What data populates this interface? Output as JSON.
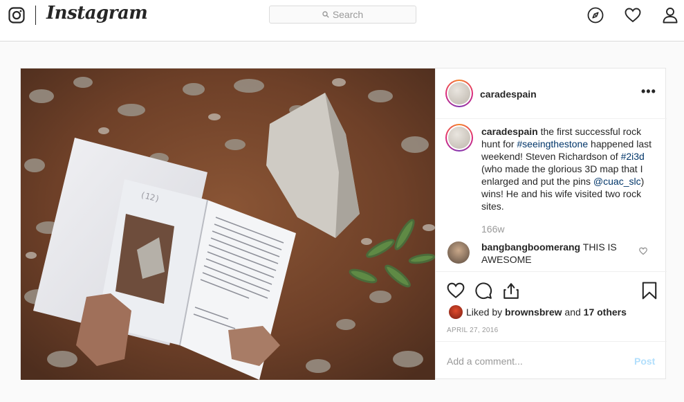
{
  "nav": {
    "logo_icon": "instagram-camera-icon",
    "wordmark": "Instagram",
    "search_placeholder": "Search",
    "icons": [
      "compass-icon",
      "heart-icon",
      "profile-icon"
    ]
  },
  "post": {
    "username": "caradespain",
    "more_label": "•••",
    "caption": {
      "author": "caradespain",
      "t1": " the first successful rock hunt for ",
      "tag1": "#seeingthestone",
      "t2": " happened last weekend! Steven Richardson of ",
      "tag2": "#2i3d",
      "t3": " (who made the glorious 3D map that I enlarged and put the pins ",
      "mention": "@cuac_slc",
      "t4": ") wins! He and his wife visited two rock sites."
    },
    "time_ago": "166w",
    "comment": {
      "author": "bangbangboomerang",
      "text": " THIS IS AWESOME"
    },
    "likes": {
      "prefix": "Liked by ",
      "user": "brownsbrew",
      "middle": " and ",
      "others": "17 others"
    },
    "date": "APRIL 27, 2016",
    "add_comment_placeholder": "Add a comment...",
    "post_button": "Post"
  },
  "colors": {
    "link": "#003569",
    "muted": "#999999",
    "post_button_disabled": "#b2dffc",
    "border": "#dbdbdb"
  }
}
